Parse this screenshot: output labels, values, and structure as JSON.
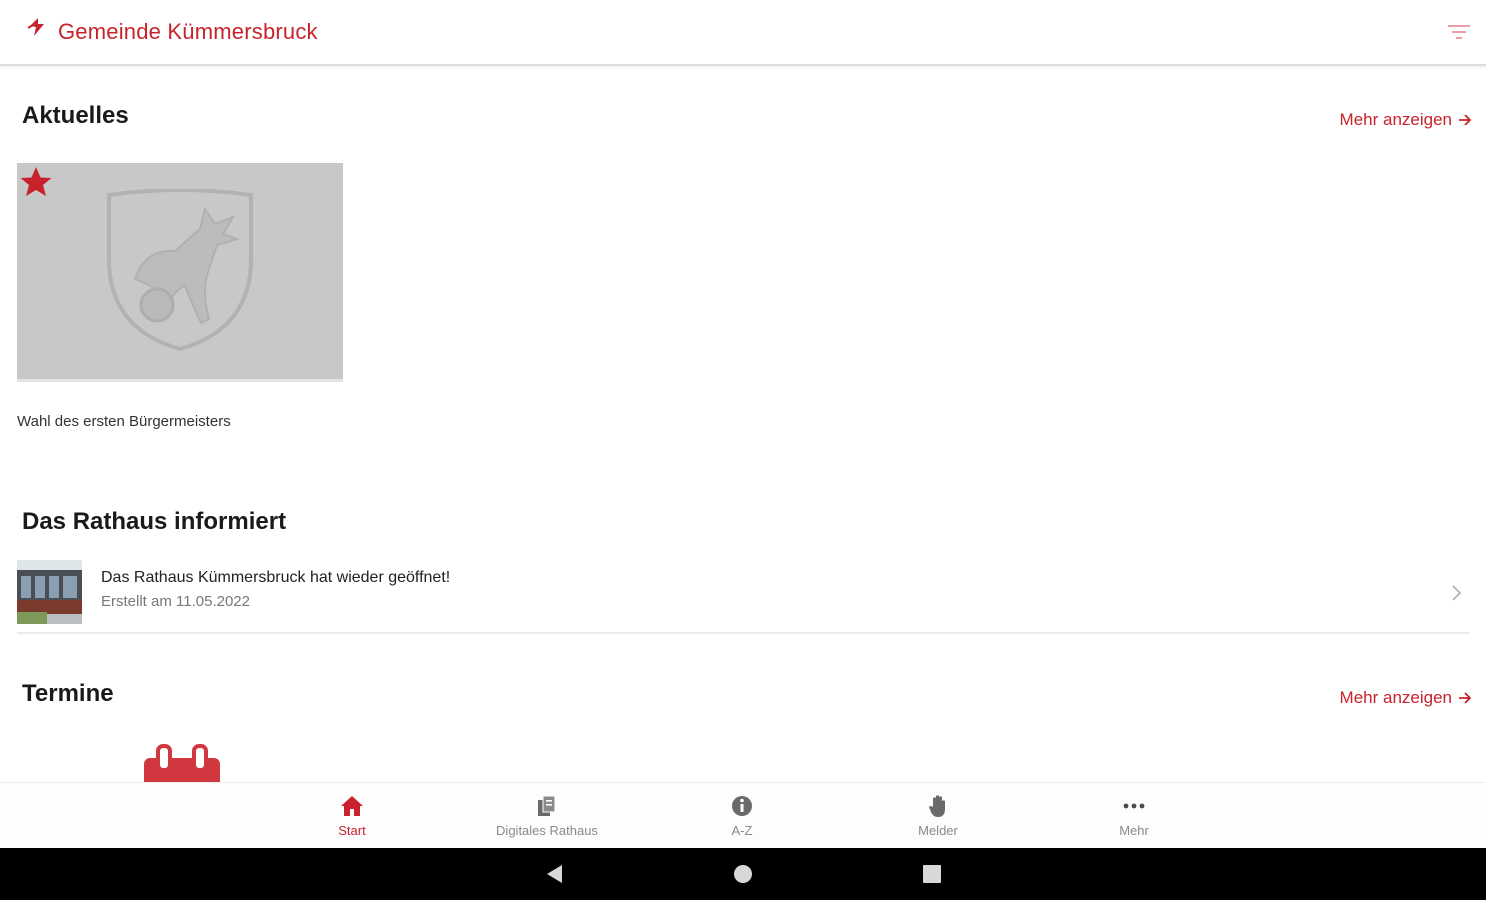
{
  "app_bar": {
    "title": "Gemeinde Kümmersbruck"
  },
  "colors": {
    "accent": "#c8232c",
    "image_placeholder": "#c8c8c8",
    "text_primary": "#1a1a1a",
    "text_secondary": "#777777"
  },
  "aktuelles": {
    "title": "Aktuelles",
    "more_label": "Mehr anzeigen",
    "card": {
      "caption": "Wahl des ersten Bürgermeisters"
    }
  },
  "rathaus": {
    "title": "Das Rathaus informiert",
    "item": {
      "title": "Das Rathaus Kümmersbruck hat wieder geöffnet!",
      "date": "Erstellt am 11.05.2022"
    }
  },
  "termine": {
    "title": "Termine",
    "more_label": "Mehr anzeigen"
  },
  "bottom_nav": {
    "items": [
      {
        "label": "Start",
        "icon": "home-icon",
        "active": true
      },
      {
        "label": "Digitales Rathaus",
        "icon": "documents-icon",
        "active": false
      },
      {
        "label": "A-Z",
        "icon": "info-icon",
        "active": false
      },
      {
        "label": "Melder",
        "icon": "hand-icon",
        "active": false
      },
      {
        "label": "Mehr",
        "icon": "more-icon",
        "active": false
      }
    ]
  },
  "system_bar": {
    "icons": [
      "back-icon",
      "home-circle-icon",
      "recents-icon"
    ]
  }
}
